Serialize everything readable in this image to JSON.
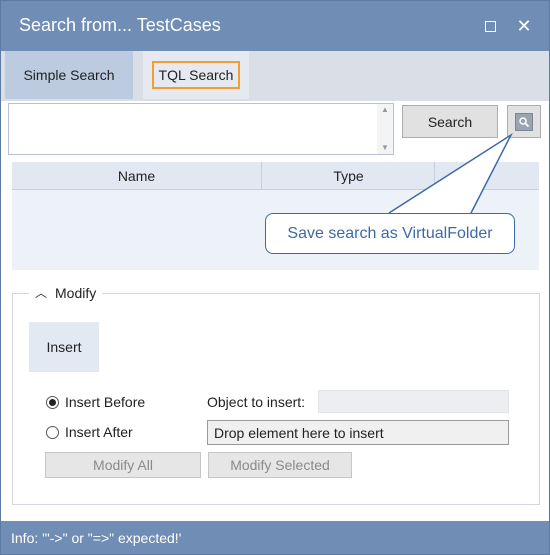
{
  "window": {
    "title": "Search from... TestCases"
  },
  "tabs": [
    {
      "label": "Simple Search",
      "selected": true
    },
    {
      "label": "TQL Search",
      "selected": false
    }
  ],
  "query": {
    "value": ""
  },
  "toolbar": {
    "search_label": "Search",
    "save_icon": "save-search-icon"
  },
  "grid": {
    "columns": [
      "Name",
      "Type"
    ],
    "rows": []
  },
  "callout": {
    "text": "Save search as VirtualFolder"
  },
  "modify": {
    "legend": "Modify",
    "insert_tab": "Insert",
    "insert_before_label": "Insert Before",
    "insert_after_label": "Insert After",
    "insert_before_checked": true,
    "object_to_insert_label": "Object to insert:",
    "object_to_insert_value": "",
    "drop_placeholder": "Drop element here to insert",
    "modify_all_label": "Modify All",
    "modify_selected_label": "Modify Selected"
  },
  "status": {
    "text": "Info: '\"->\" or \"=>\" expected!'"
  },
  "colors": {
    "titlebar": "#6f8db5",
    "focus": "#f0a030",
    "callout": "#3d6aa6"
  }
}
